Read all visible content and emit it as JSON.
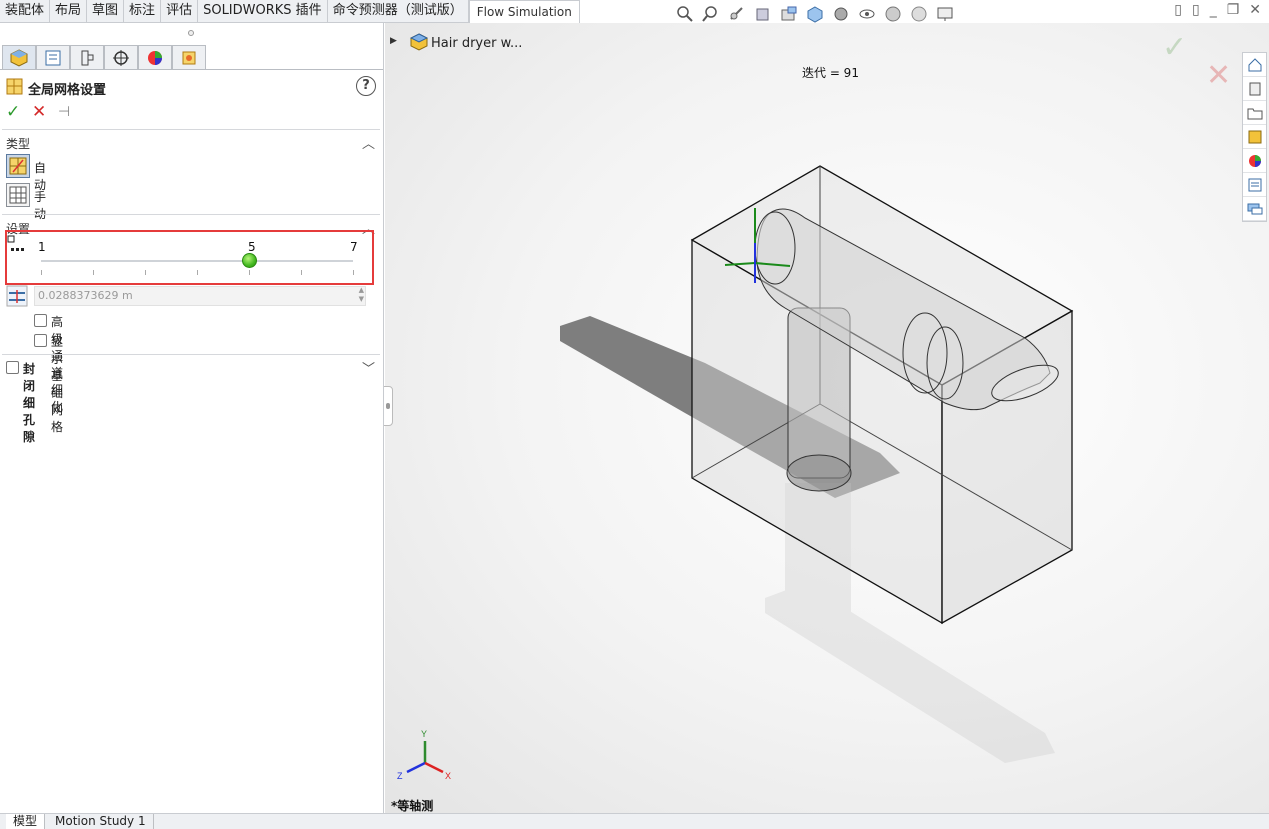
{
  "command_tabs": [
    "装配体",
    "布局",
    "草图",
    "标注",
    "评估",
    "SOLIDWORKS 插件",
    "命令预测器（测试版）",
    "Flow Simulation"
  ],
  "active_command_tab": "Flow Simulation",
  "property_manager": {
    "title": "全局网格设置",
    "help_label": "?",
    "ok_symbol": "✓",
    "cancel_symbol": "✕",
    "pin_symbol": "⊣",
    "type_section": {
      "title": "类型",
      "options": [
        {
          "label": "自动",
          "selected": true
        },
        {
          "label": "手动",
          "selected": false
        }
      ]
    },
    "settings_section": {
      "title": "设置",
      "level_slider": {
        "min_label": "1",
        "mid_label": "5",
        "max_label": "7",
        "min": 1,
        "max": 7,
        "value": 5
      }
    },
    "min_gap_value": "0.0288373629 m",
    "checkboxes": [
      {
        "label": "高级通道细化",
        "checked": false
      },
      {
        "label": "显示基础网格",
        "checked": false
      }
    ],
    "close_thin_slots": {
      "label": "封闭细孔隙",
      "checked": false
    }
  },
  "viewport": {
    "tree_item": "Hair dryer w...",
    "iteration_text": "迭代 = 91",
    "view_label": "*等轴测",
    "axis_labels": {
      "x": "X",
      "y": "Y",
      "z": "Z"
    }
  },
  "bottom_tabs": [
    "模型",
    "Motion Study 1"
  ],
  "colors": {
    "accent_red": "#e53b3b",
    "thumb_green": "#43b820"
  }
}
